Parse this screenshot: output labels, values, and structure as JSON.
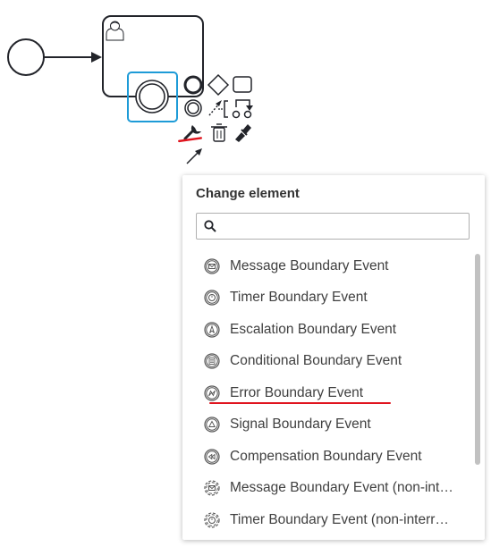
{
  "palette": {
    "stroke": "#22242a",
    "selection": "#1e9bd7",
    "highlight": "#e0141e",
    "text": "#404040"
  },
  "diagram": {
    "start_event": "start-event-circle",
    "task": "user-task",
    "task_icon": "user-icon",
    "boundary_event": "intermediate-event"
  },
  "context_pad": {
    "row1": [
      "intermediate-event-icon",
      "gateway-icon",
      "task-icon"
    ],
    "row2": [
      "end-event-icon",
      "connect-icon",
      "text-annotation-icon",
      "append-icon"
    ],
    "row3": [
      "wrench-icon",
      "trash-icon",
      "color-picker-icon"
    ],
    "row4": [
      "arrow-connect-icon"
    ]
  },
  "popup": {
    "title": "Change element",
    "search_placeholder": "",
    "entries": [
      {
        "label": "Message Boundary Event",
        "icon": "message-icon"
      },
      {
        "label": "Timer Boundary Event",
        "icon": "timer-icon"
      },
      {
        "label": "Escalation Boundary Event",
        "icon": "escalation-icon"
      },
      {
        "label": "Conditional Boundary Event",
        "icon": "conditional-icon"
      },
      {
        "label": "Error Boundary Event",
        "icon": "error-icon"
      },
      {
        "label": "Signal Boundary Event",
        "icon": "signal-icon"
      },
      {
        "label": "Compensation Boundary Event",
        "icon": "compensation-icon"
      },
      {
        "label": "Message Boundary Event (non-int…",
        "icon": "message-noninterrupting-icon"
      },
      {
        "label": "Timer Boundary Event (non-interr…",
        "icon": "timer-noninterrupting-icon"
      }
    ]
  }
}
